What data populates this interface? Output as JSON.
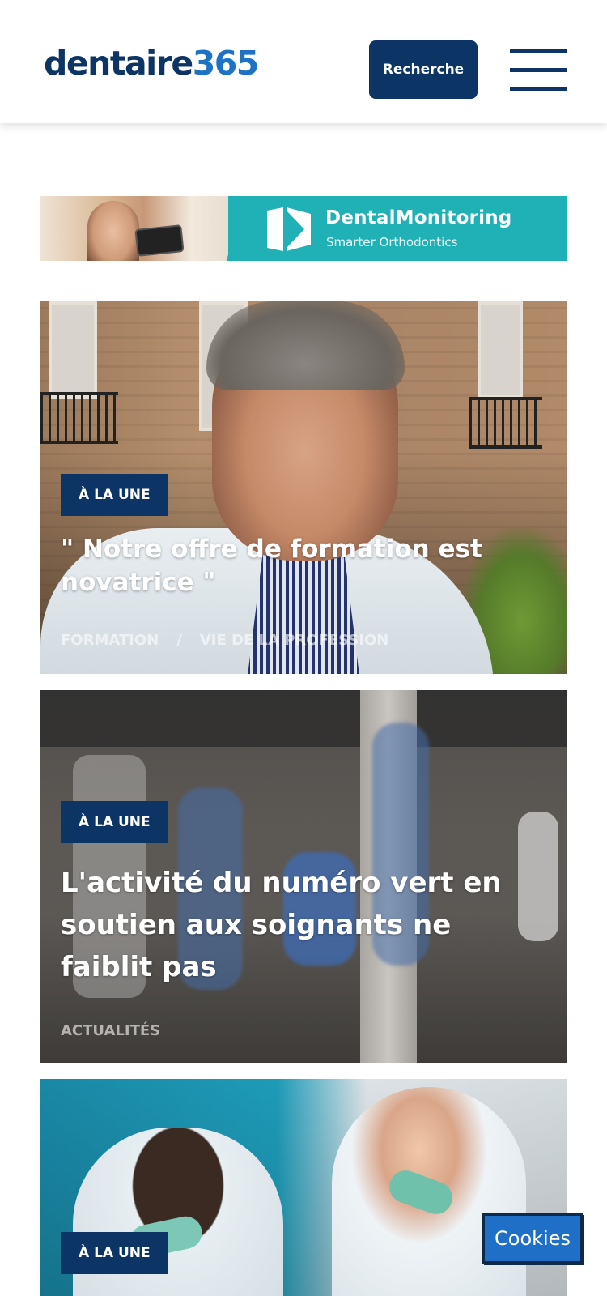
{
  "header": {
    "logo_part1": "dentaire",
    "logo_part2": "365",
    "search_label": "Recherche",
    "colors": {
      "navy": "#0c3464",
      "brand_blue": "#1c72c4"
    }
  },
  "banner": {
    "brand": "DentalMonitoring",
    "tagline": "Smarter Orthodontics",
    "color": "#1fb1b5"
  },
  "articles": [
    {
      "tag": "À LA UNE",
      "title": "\" Notre offre de formation est novatrice \"",
      "categories": [
        "FORMATION",
        "/",
        "VIE DE LA PROFESSION"
      ]
    },
    {
      "tag": "À LA UNE",
      "title": "L'activité du numéro vert en soutien aux soignants ne faiblit pas",
      "categories": [
        "ACTUALITÉS"
      ]
    },
    {
      "tag": "À LA UNE"
    }
  ],
  "cookies": {
    "label": "Cookies",
    "color": "#1f6fc7"
  }
}
